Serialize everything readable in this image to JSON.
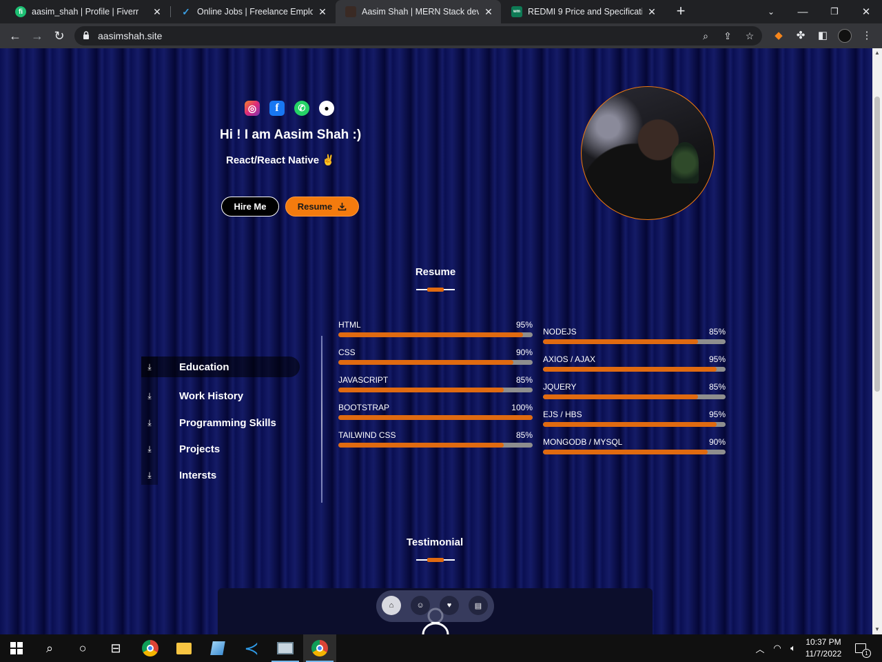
{
  "browser": {
    "tabs": [
      {
        "title": "aasim_shah | Profile | Fiverr",
        "favicon": "fiverr-icon",
        "favicon_text": "fi",
        "favicon_color": "#1dbf73"
      },
      {
        "title": "Online Jobs | Freelance Employment",
        "favicon": "upwork-icon",
        "favicon_text": "✓",
        "favicon_color": "#2a6fdb"
      },
      {
        "title": "Aasim Shah | MERN Stack developer",
        "favicon": "profile-photo-icon",
        "favicon_text": "",
        "favicon_color": "#3a2a24"
      },
      {
        "title": "REDMI 9 Price and Specifications",
        "favicon": "whatmobile-icon",
        "favicon_text": "wm",
        "favicon_color": "#0e7a55"
      }
    ],
    "active_tab": 2,
    "url": "aasimshah.site"
  },
  "hero": {
    "greeting": "Hi ! I am Aasim Shah :)",
    "role": "React/React Native ✌",
    "hire_label": "Hire Me",
    "resume_label": "Resume",
    "socials": [
      {
        "name": "instagram-icon",
        "glyph": "◎",
        "color": "#c13584"
      },
      {
        "name": "facebook-icon",
        "glyph": "f",
        "color": "#1877f2"
      },
      {
        "name": "whatsapp-icon",
        "glyph": "✆",
        "color": "#25d366"
      },
      {
        "name": "github-icon",
        "glyph": "⌂",
        "color": "#ffffff"
      }
    ]
  },
  "resume": {
    "title": "Resume",
    "tabs": [
      {
        "label": "Education",
        "active": true
      },
      {
        "label": "Work History",
        "active": false
      },
      {
        "label": "Programming Skills",
        "active": false
      },
      {
        "label": "Projects",
        "active": false
      },
      {
        "label": "Intersts",
        "active": false
      }
    ],
    "skills_left": [
      {
        "name": "HTML",
        "percent": 95,
        "label": "95%"
      },
      {
        "name": "CSS",
        "percent": 90,
        "label": "90%"
      },
      {
        "name": "JAVASCRIPT",
        "percent": 85,
        "label": "85%"
      },
      {
        "name": "BOOTSTRAP",
        "percent": 100,
        "label": "100%"
      },
      {
        "name": "TAILWIND CSS",
        "percent": 85,
        "label": "85%"
      }
    ],
    "skills_right": [
      {
        "name": "NODEJS",
        "percent": 85,
        "label": "85%"
      },
      {
        "name": "AXIOS / AJAX",
        "percent": 95,
        "label": "95%"
      },
      {
        "name": "JQUERY",
        "percent": 85,
        "label": "85%"
      },
      {
        "name": "EJS / HBS",
        "percent": 95,
        "label": "95%"
      },
      {
        "name": "MONGODB / MYSQL",
        "percent": 90,
        "label": "90%"
      }
    ]
  },
  "testimonial": {
    "title": "Testimonial"
  },
  "colors": {
    "accent": "#e06a10",
    "background": "#0a0f52"
  },
  "taskbar": {
    "time": "10:37 PM",
    "date": "11/7/2022",
    "notification_count": "1"
  }
}
